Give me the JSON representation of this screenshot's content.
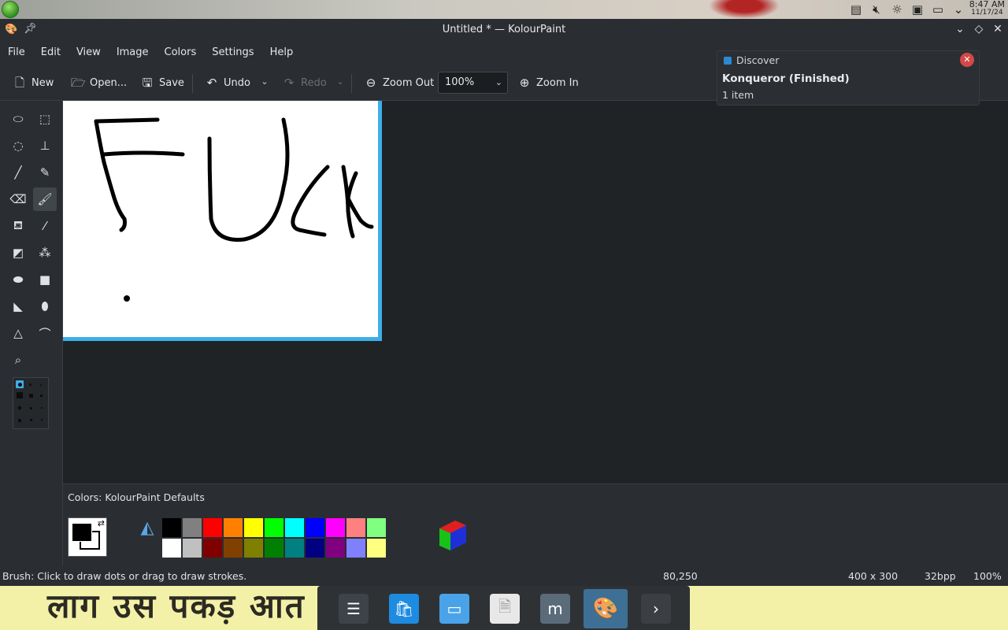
{
  "system": {
    "time": "8:47 AM",
    "date": "11/17/24",
    "tray_icons": [
      "clipboard-icon",
      "volume-muted-icon",
      "brightness-icon",
      "save-device-icon",
      "display-icon",
      "chevron-down-icon"
    ]
  },
  "window": {
    "title": "Untitled * — KolourPaint"
  },
  "menu": [
    "File",
    "Edit",
    "View",
    "Image",
    "Colors",
    "Settings",
    "Help"
  ],
  "toolbar": {
    "new": "New",
    "open": "Open...",
    "save": "Save",
    "undo": "Undo",
    "redo": "Redo",
    "zoom_out": "Zoom Out",
    "zoom_value": "100%",
    "zoom_in": "Zoom In"
  },
  "tools": [
    "free-form-selection",
    "rectangular-selection",
    "elliptical-selection",
    "text-tool",
    "line-tool",
    "pen-tool",
    "eraser-tool",
    "brush-tool",
    "flood-fill-tool",
    "color-picker-tool",
    "color-eraser-tool",
    "spraycan-tool",
    "ellipse-tool",
    "rectangle-tool",
    "polygon-tool",
    "rounded-rectangle-tool",
    "polyline-tool",
    "curve-tool",
    "zoom-tool"
  ],
  "active_tool": "brush-tool",
  "notification": {
    "app": "Discover",
    "heading": "Konqueror (Finished)",
    "body": "1 item"
  },
  "palette": {
    "title": "Colors: KolourPaint Defaults",
    "foreground": "#000000",
    "background": "#ffffff",
    "row1": [
      "#000000",
      "#808080",
      "#ff0000",
      "#ff8000",
      "#ffff00",
      "#00ff00",
      "#00ffff",
      "#0000ff",
      "#ff00ff",
      "#ff8080",
      "#80ff80"
    ],
    "row2": [
      "#ffffff",
      "#c0c0c0",
      "#800000",
      "#804000",
      "#808000",
      "#008000",
      "#008080",
      "#000080",
      "#800080",
      "#8080ff",
      "#ffff80"
    ]
  },
  "status": {
    "message": "Brush: Click to draw dots or drag to draw strokes.",
    "coords": "80,250",
    "size": "400 x 300",
    "depth": "32bpp",
    "zoom": "100%"
  },
  "canvas_drawing_text": "FUck",
  "desktop_text": "लाग उस पकड़ आत हा.",
  "dock": [
    "settings-app",
    "discover-app",
    "file-manager-app",
    "document-app",
    "mousepad-app",
    "kolourpaint-app",
    "more-arrow"
  ]
}
